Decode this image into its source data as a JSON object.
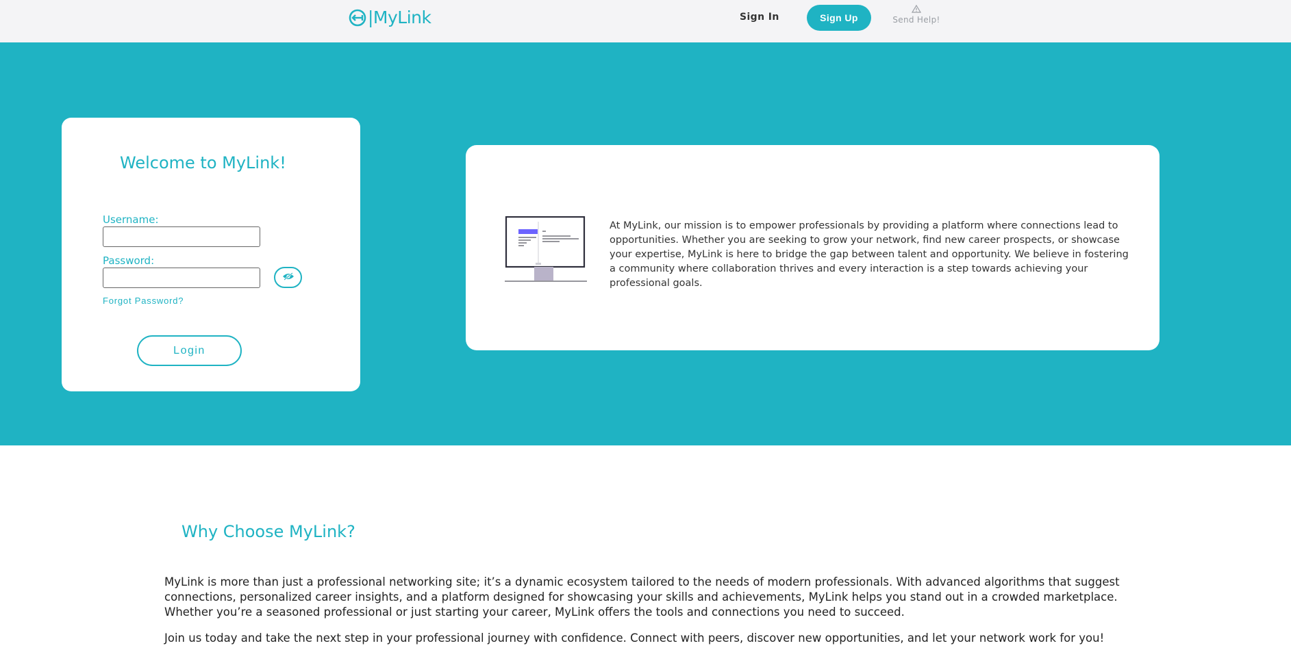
{
  "header": {
    "logo_text": "|MyLink",
    "sign_in": "Sign In",
    "sign_up": "Sign Up",
    "help": "Send Help!"
  },
  "login": {
    "title": "Welcome to MyLink!",
    "username_label": "Username:",
    "username_value": "",
    "password_label": "Password:",
    "password_value": "",
    "forgot": "Forgot Password?",
    "login_button": "Login"
  },
  "mission": {
    "text": "At MyLink, our mission is to empower professionals by providing a platform where connections lead to opportunities. Whether you are seeking to grow your network, find new career prospects, or showcase your expertise, MyLink is here to bridge the gap between talent and opportunity. We believe in fostering a community where collaboration thrives and every interaction is a step towards achieving your professional goals."
  },
  "why": {
    "title": "Why Choose MyLink?",
    "p1": "MyLink is more than just a professional networking site; it’s a dynamic ecosystem tailored to the needs of modern professionals. With advanced algorithms that suggest connections, personalized career insights, and a platform designed for showcasing your skills and achievements, MyLink helps you stand out in a crowded marketplace. Whether you’re a seasoned professional or just starting your career, MyLink offers the tools and connections you need to succeed.",
    "p2": "Join us today and take the next step in your professional journey with confidence. Connect with peers, discover new opportunities, and let your network work for you!"
  },
  "icons": {
    "logo": "link-circle-icon",
    "help": "warning-triangle-icon",
    "password_toggle": "eye-slash-icon",
    "illustration": "monitor-illustration"
  },
  "colors": {
    "accent": "#1fb3c3",
    "header_bg": "#f4f4f6",
    "text": "#333333"
  }
}
